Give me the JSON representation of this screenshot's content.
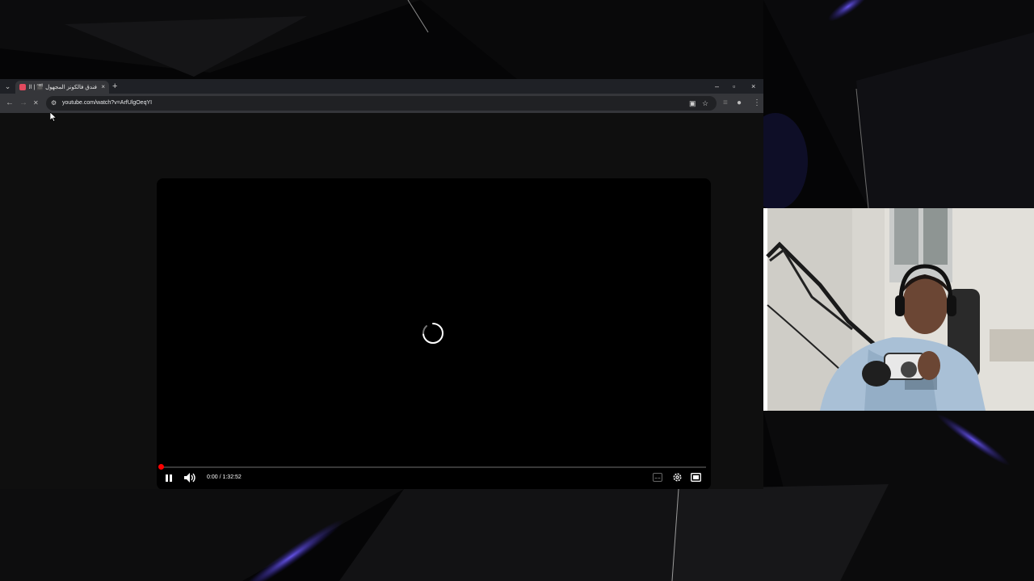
{
  "browser": {
    "tab": {
      "title": "فندق فالكونز المجهول 🎬 | الحلـ",
      "close_glyph": "×"
    },
    "new_tab_glyph": "+",
    "window_controls": {
      "minimize": "–",
      "maximize": "▫",
      "close": "×"
    },
    "nav": {
      "back": "←",
      "forward": "→",
      "stop": "✕"
    },
    "address_bar": {
      "url": "youtube.com/watch?v=ArfUlgOeqYI"
    },
    "colors": {
      "tabstrip": "#1f2126",
      "toolbar": "#35363a",
      "omnibox": "#202124"
    }
  },
  "player": {
    "state": "loading",
    "current_time": "0:00",
    "duration": "1:32:52",
    "time_separator": " / ",
    "progress": 0,
    "colors": {
      "progress": "#ff0000",
      "background": "#000000"
    },
    "icons": [
      "pause-icon",
      "volume-icon",
      "captions-icon",
      "settings-gear-icon",
      "theater-mode-icon"
    ]
  },
  "webcam": {
    "description_icon": "streamer-webcam-feed"
  }
}
